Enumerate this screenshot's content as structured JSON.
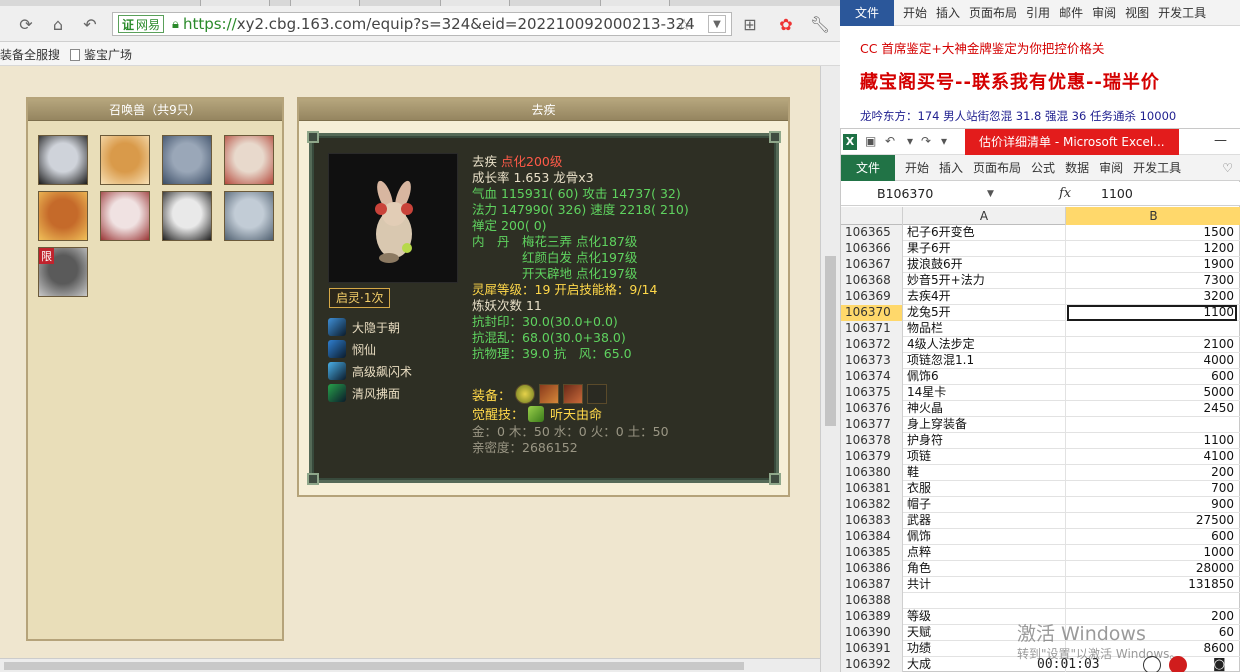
{
  "browser": {
    "url_cert": "网易",
    "url_https": "https://",
    "url_rest": "xy2.cbg.163.com/equip?s=324&eid=202210092000213-324",
    "bookmarks": [
      "装备全服搜",
      "鉴宝广场"
    ]
  },
  "summons_panel": {
    "title": "召唤兽（共9只）",
    "limited_badge": "限",
    "avatars": [
      {
        "color": "#cfd3da",
        "accent": "#1c1c1c"
      },
      {
        "color": "#d99a4a",
        "accent": "#f7e0b5"
      },
      {
        "color": "#9aa7b8",
        "accent": "#3b4d66"
      },
      {
        "color": "#e8d9cc",
        "accent": "#b54a3d"
      },
      {
        "color": "#c56a2a",
        "accent": "#f1c15a"
      },
      {
        "color": "#f0e2e2",
        "accent": "#9a3535"
      },
      {
        "color": "#e9e9e9",
        "accent": "#202020"
      },
      {
        "color": "#c2ccd6",
        "accent": "#506070"
      },
      {
        "color": "#5a5a5a",
        "accent": "#c9c9c9"
      }
    ]
  },
  "detail_panel": {
    "title": "去疾",
    "qiling": "启灵·1次",
    "skills": [
      {
        "label": "大隐于朝",
        "icon": "hidden-sage-icon",
        "color": "#3f8fd6"
      },
      {
        "label": "悯仙",
        "icon": "horseshoe-icon",
        "color": "#2f7fd0"
      },
      {
        "label": "高级飙闪术",
        "icon": "wind-flash-icon",
        "color": "#4ab0e8"
      },
      {
        "label": "清风拂面",
        "icon": "green-eye-icon",
        "color": "#27a14a"
      }
    ],
    "stats": {
      "name": "去疾",
      "dianhua": "点化200级",
      "growth_label": "成长率",
      "growth": "1.653",
      "longgu": "龙骨x3",
      "hp_label": "气血",
      "hp": "115931",
      "hp_pt": "( 60)",
      "atk_label": "攻击",
      "atk": "14737",
      "atk_pt": "( 32)",
      "mp_label": "法力",
      "mp": "147990",
      "mp_pt": "( 326)",
      "spd_label": "速度",
      "spd": "2218",
      "spd_pt": "( 210)",
      "zen_label": "禅定",
      "zen": "200",
      "zen_pt": "( 0)",
      "neidan_label": "内　丹",
      "neidan": [
        {
          "name": "梅花三弄",
          "level": "点化187级"
        },
        {
          "name": "红颜白发",
          "level": "点化197级"
        },
        {
          "name": "开天辟地",
          "level": "点化197级"
        }
      ],
      "linxi": "灵犀等级：19 开启技能格：9/14",
      "lianyao": "炼妖次数 11",
      "kangfeng": "抗封印：30.0(30.0+0.0)",
      "kanghun": "抗混乱：68.0(30.0+38.0)",
      "kangwu": "抗物理：39.0 抗　风：65.0"
    },
    "equip_label": "装备：",
    "wake_label": "觉醒技：",
    "wake_skill": "听天由命",
    "elements": "金：0 木：50 水：0 火：0 土：50",
    "intimacy": "亲密度：2686152"
  },
  "word": {
    "file_tab": "文件",
    "tabs": [
      "开始",
      "插入",
      "页面布局",
      "引用",
      "邮件",
      "审阅",
      "视图",
      "开发工具"
    ],
    "line1": "CC 首席鉴定+大神金牌鉴定为你把控价格关",
    "line2": "藏宝阁买号--联系我有优惠--瑞半价",
    "line3": "龙吟东方：174 男人站街忽混 31.8 强混 36 任务通杀 10000"
  },
  "excel": {
    "title": "估价详细清单 - Microsoft Excel...",
    "file_tab": "文件",
    "tabs": [
      "开始",
      "插入",
      "页面布局",
      "公式",
      "数据",
      "审阅",
      "开发工具"
    ],
    "name_box": "B106370",
    "formula_value": "1100",
    "col_a": "A",
    "col_b": "B",
    "rows": [
      {
        "n": "106365",
        "a": "杞子6开变色",
        "b": "1500"
      },
      {
        "n": "106366",
        "a": "果子6开",
        "b": "1200"
      },
      {
        "n": "106367",
        "a": "拔浪鼓6开",
        "b": "1900"
      },
      {
        "n": "106368",
        "a": "妙音5开+法力",
        "b": "7300"
      },
      {
        "n": "106369",
        "a": "去疾4开",
        "b": "3200"
      },
      {
        "n": "106370",
        "a": "龙兔5开",
        "b": "1100"
      },
      {
        "n": "106371",
        "a": "物品栏",
        "b": ""
      },
      {
        "n": "106372",
        "a": "4级人法步定",
        "b": "2100"
      },
      {
        "n": "106373",
        "a": "项链忽混1.1",
        "b": "4000"
      },
      {
        "n": "106374",
        "a": "佩饰6",
        "b": "600"
      },
      {
        "n": "106375",
        "a": "14星卡",
        "b": "5000"
      },
      {
        "n": "106376",
        "a": "神火晶",
        "b": "2450"
      },
      {
        "n": "106377",
        "a": "身上穿装备",
        "b": ""
      },
      {
        "n": "106378",
        "a": "护身符",
        "b": "1100"
      },
      {
        "n": "106379",
        "a": "项链",
        "b": "4100"
      },
      {
        "n": "106380",
        "a": "鞋",
        "b": "200"
      },
      {
        "n": "106381",
        "a": "衣服",
        "b": "700"
      },
      {
        "n": "106382",
        "a": "帽子",
        "b": "900"
      },
      {
        "n": "106383",
        "a": "武器",
        "b": "27500"
      },
      {
        "n": "106384",
        "a": "佩饰",
        "b": "600"
      },
      {
        "n": "106385",
        "a": "点粹",
        "b": "1000"
      },
      {
        "n": "106386",
        "a": "角色",
        "b": "28000"
      },
      {
        "n": "106387",
        "a": "共计",
        "b": "131850"
      },
      {
        "n": "106388",
        "a": "",
        "b": ""
      },
      {
        "n": "106389",
        "a": "等级",
        "b": "200"
      },
      {
        "n": "106390",
        "a": "天赋",
        "b": "60"
      },
      {
        "n": "106391",
        "a": "功绩",
        "b": "8600"
      },
      {
        "n": "106392",
        "a": "大成",
        "b": ""
      }
    ],
    "selected_row": "106370",
    "activate_title": "激活 Windows",
    "activate_sub": "转到\"设置\"以激活 Windows。",
    "rec_time": "00:01:03"
  }
}
